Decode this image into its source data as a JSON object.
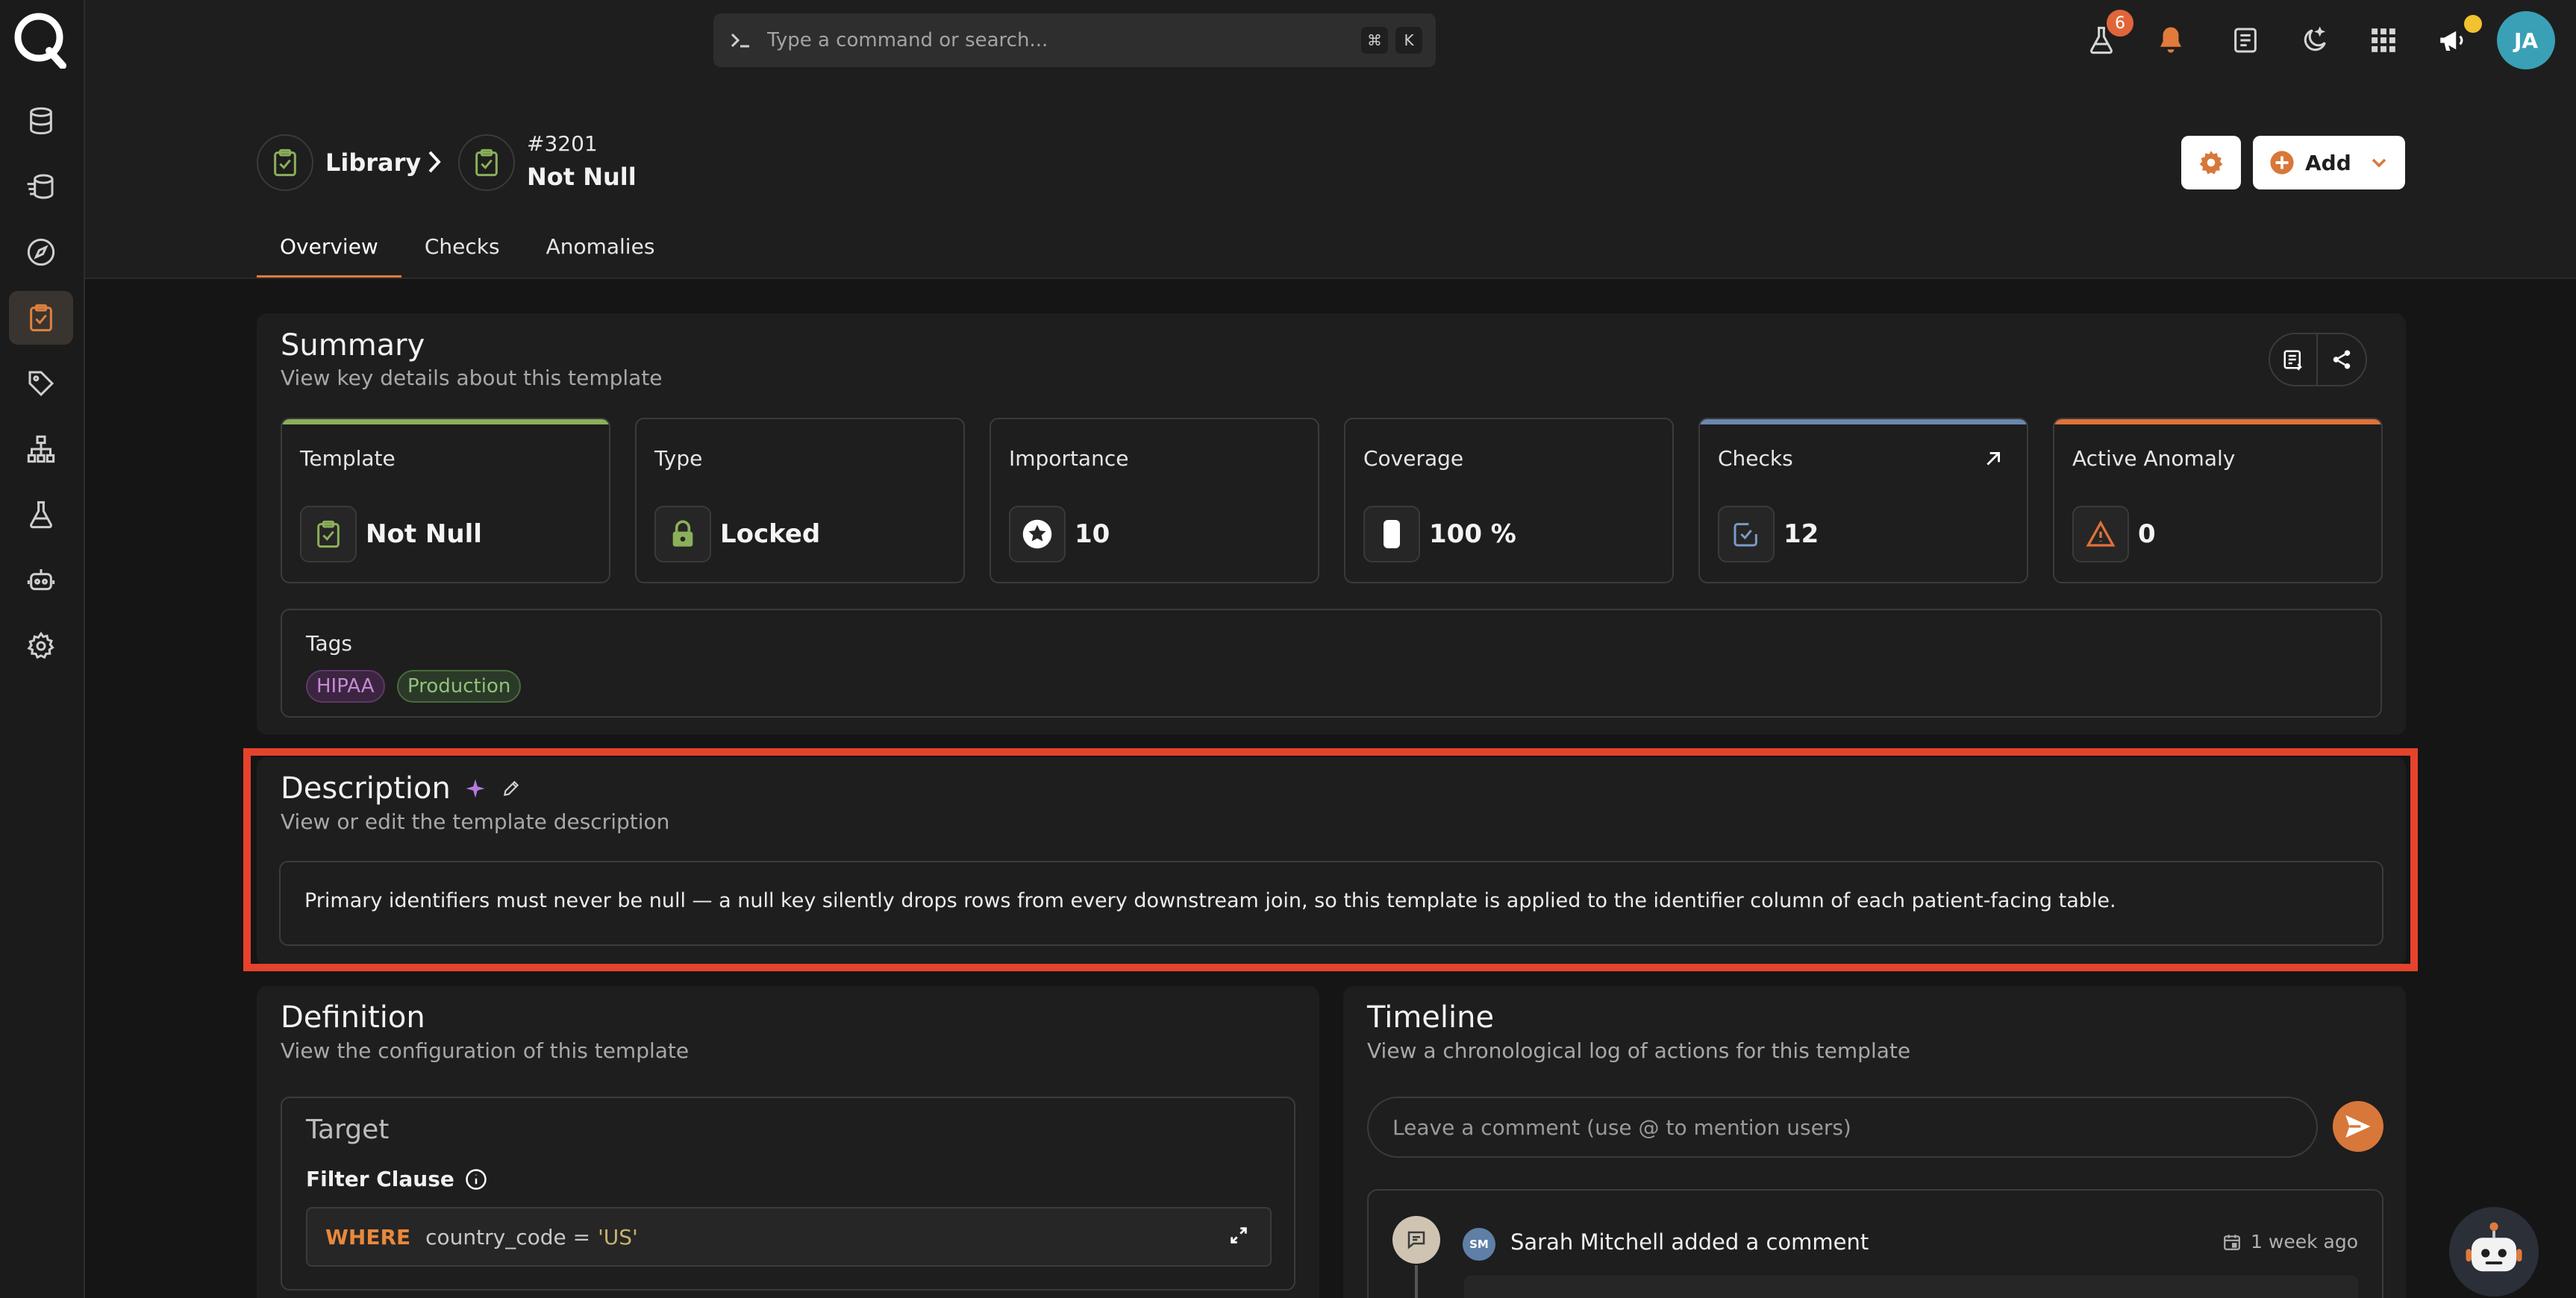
{
  "topbar": {
    "search_placeholder": "Type a command or search...",
    "shortcut_keys": [
      "⌘",
      "K"
    ],
    "notification_count": "6",
    "avatar_initials": "JA",
    "icons": [
      "flask-icon",
      "bell-icon",
      "document-icon",
      "moon-icon",
      "grid-icon",
      "megaphone-icon"
    ]
  },
  "sidebar": {
    "items": [
      {
        "icon": "database-icon"
      },
      {
        "icon": "datastore-flow-icon"
      },
      {
        "icon": "compass-icon"
      },
      {
        "icon": "clipboard-check-icon",
        "active": true
      },
      {
        "icon": "tag-icon"
      },
      {
        "icon": "hierarchy-icon"
      },
      {
        "icon": "flask-icon"
      },
      {
        "icon": "robot-icon"
      },
      {
        "icon": "gear-icon"
      }
    ]
  },
  "header": {
    "breadcrumb_root": "Library",
    "template_id": "#3201",
    "template_name": "Not Null",
    "add_label": "Add"
  },
  "tabs": [
    "Overview",
    "Checks",
    "Anomalies"
  ],
  "summary": {
    "title": "Summary",
    "subtitle": "View key details about this template",
    "stats": [
      {
        "label": "Template",
        "value": "Not Null",
        "icon": "clipboard-check-icon",
        "accent": "#8bb05a"
      },
      {
        "label": "Type",
        "value": "Locked",
        "icon": "lock-icon"
      },
      {
        "label": "Importance",
        "value": "10",
        "icon": "star-icon"
      },
      {
        "label": "Coverage",
        "value": "100 %",
        "icon": "coverage-icon"
      },
      {
        "label": "Checks",
        "value": "12",
        "icon": "check-square-icon",
        "accent": "#6a87b0"
      },
      {
        "label": "Active Anomaly",
        "value": "0",
        "icon": "warning-icon",
        "accent": "#e0713a"
      }
    ],
    "tags_label": "Tags",
    "tags": [
      {
        "label": "HIPAA",
        "color": "#c48ad6"
      },
      {
        "label": "Production",
        "color": "#8fc27a"
      }
    ]
  },
  "description": {
    "title": "Description",
    "subtitle": "View or edit the template description",
    "text": "Primary identifiers must never be null — a null key silently drops rows from every downstream join, so this template is applied to the identifier column of each patient-facing table."
  },
  "definition": {
    "title": "Definition",
    "subtitle": "View the configuration of this template",
    "target_title": "Target",
    "filter_label": "Filter Clause",
    "filter_keyword": "WHERE",
    "filter_expression": "country_code =",
    "filter_value": "'US'"
  },
  "timeline": {
    "title": "Timeline",
    "subtitle": "View a chronological log of actions for this template",
    "comment_placeholder": "Leave a comment (use @ to mention users)",
    "events": [
      {
        "initials": "SM",
        "text": "Sarah Mitchell added a comment",
        "time": "1 week ago"
      }
    ]
  },
  "colors": {
    "accent": "#e07b3c",
    "highlight": "#e5432c"
  }
}
